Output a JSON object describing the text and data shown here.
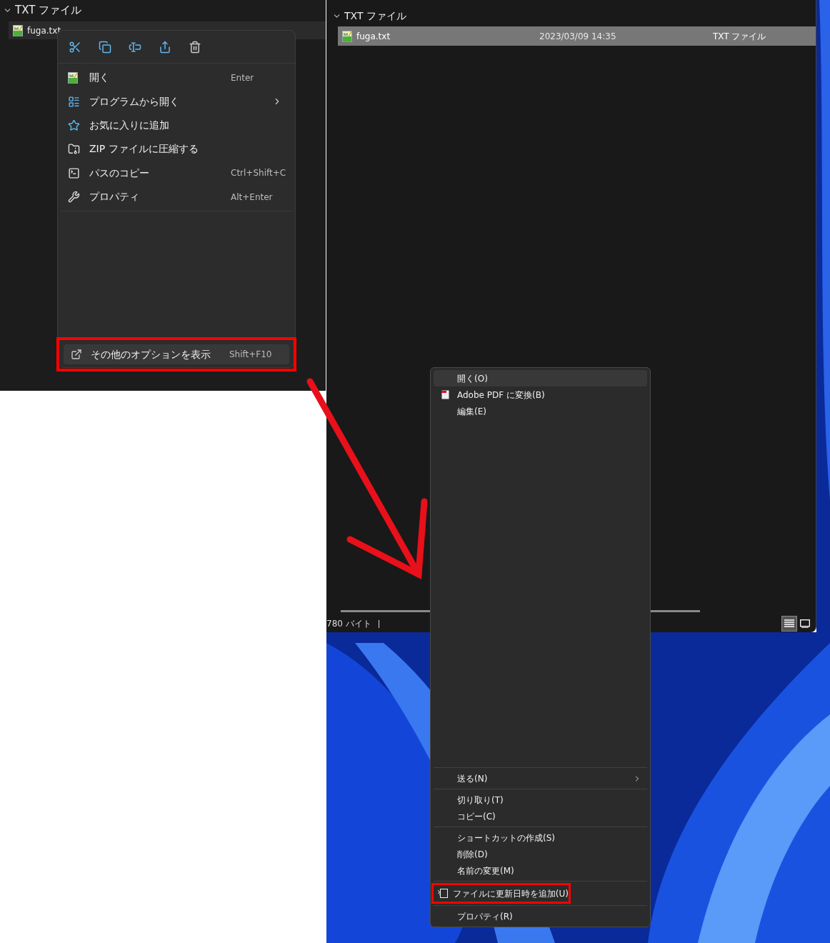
{
  "left_panel": {
    "group_header": "TXT ファイル",
    "file": "fuga.txt",
    "context_menu": {
      "items": [
        {
          "label": "開く",
          "shortcut": "Enter",
          "has_submenu": false
        },
        {
          "label": "プログラムから開く",
          "has_submenu": true
        },
        {
          "label": "お気に入りに追加",
          "has_submenu": false
        },
        {
          "label": "ZIP ファイルに圧縮する",
          "has_submenu": false
        },
        {
          "label": "パスのコピー",
          "shortcut": "Ctrl+Shift+C",
          "has_submenu": false
        },
        {
          "label": "プロパティ",
          "shortcut": "Alt+Enter",
          "has_submenu": false
        }
      ],
      "more_options": {
        "label": "その他のオプションを表示",
        "shortcut": "Shift+F10",
        "selected": true,
        "emphasized": true
      }
    }
  },
  "right_window": {
    "group_header": "TXT ファイル",
    "row": {
      "name": "fuga.txt",
      "date": "2023/03/09 14:35",
      "type": "TXT ファイル",
      "selected": true
    },
    "status": "780 バイト",
    "view_buttons": [
      {
        "selected": true
      },
      {
        "selected": false
      }
    ]
  },
  "classic_menu": {
    "groups": [
      [
        {
          "label": "開く(O)",
          "selected": true,
          "has_submenu": false,
          "emphasized": false
        },
        {
          "label": "Adobe PDF に変換(B)",
          "selected": false,
          "has_submenu": false,
          "emphasized": false
        },
        {
          "label": "編集(E)",
          "selected": false,
          "has_submenu": false,
          "emphasized": false
        }
      ],
      [
        {
          "label": "送る(N)",
          "selected": false,
          "has_submenu": true,
          "emphasized": false
        }
      ],
      [
        {
          "label": "切り取り(T)",
          "selected": false,
          "has_submenu": false,
          "emphasized": false
        },
        {
          "label": "コピー(C)",
          "selected": false,
          "has_submenu": false,
          "emphasized": false
        }
      ],
      [
        {
          "label": "ショートカットの作成(S)",
          "selected": false,
          "has_submenu": false,
          "emphasized": false
        },
        {
          "label": "削除(D)",
          "selected": false,
          "has_submenu": false,
          "emphasized": false
        },
        {
          "label": "名前の変更(M)",
          "selected": false,
          "has_submenu": false,
          "emphasized": false
        }
      ],
      [
        {
          "label": "ファイルに更新日時を追加(U)",
          "selected": false,
          "has_submenu": false,
          "emphasized": true
        }
      ],
      [
        {
          "label": "プロパティ(R)",
          "selected": false,
          "has_submenu": false,
          "emphasized": false
        }
      ]
    ]
  }
}
